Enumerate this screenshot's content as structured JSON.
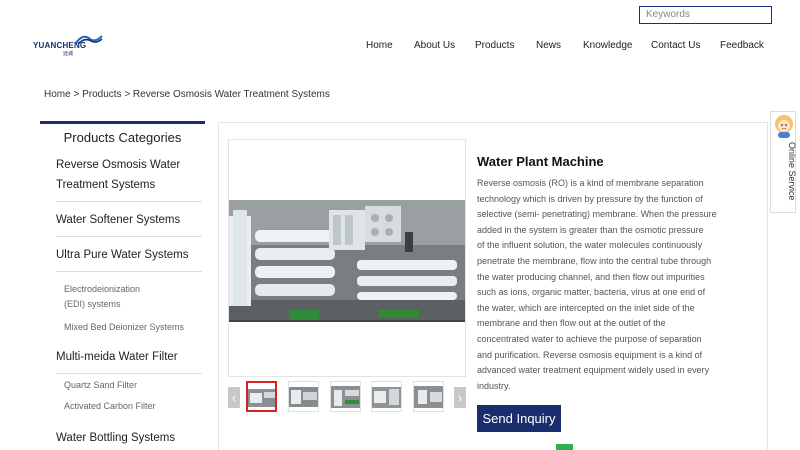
{
  "header": {
    "search_placeholder": "Keywords",
    "logo": {
      "name": "YUANCHENG",
      "sub": "远诚"
    },
    "nav": [
      "Home",
      "About Us",
      "Products",
      "News",
      "Knowledge",
      "Contact Us",
      "Feedback"
    ]
  },
  "breadcrumb": "Home > Products > Reverse Osmosis Water Treatment Systems",
  "sidebar": {
    "title": "Products Categories",
    "items": [
      {
        "label": "Reverse Osmosis Water\nTreatment Systems",
        "type": "main"
      },
      {
        "label": "Water Softener Systems",
        "type": "main"
      },
      {
        "label": "Ultra Pure Water Systems",
        "type": "main"
      },
      {
        "label": "Electrodeionization\n(EDI)  systems",
        "type": "sub"
      },
      {
        "label": "Mixed Bed Deionizer Systems",
        "type": "sub"
      },
      {
        "label": "Multi-meida Water Filter",
        "type": "main"
      },
      {
        "label": "Quartz Sand Filter",
        "type": "sub"
      },
      {
        "label": "Activated Carbon Filter",
        "type": "sub"
      },
      {
        "label": "Water Bottling Systems",
        "type": "main"
      }
    ]
  },
  "product": {
    "title": "Water Plant Machine",
    "description": "Reverse osmosis (RO) is a kind of membrane separation\ntechnology which is driven  by pressure by the function of\nselective (semi- penetrating) membrane. When the  pressure\nadded in the system is greater than the osmotic pressure\nof the influent  solution, the water molecules continuously\npenetrate the  membrane, flow into the central tube through\nthe water producing channel, and then flow out impurities\nsuch as ions, organic matter, bacteria, virus at  one end of\nthe water, which are intercepted on the inlet side of the\nmembrane  and then flow out at the outlet of the\nconcentrated water to achieve the purpose of separation\nand purification. Reverse osmosis equipment is a kind of\nadvanced water treatment equipment widely used in every\nindustry.",
    "inquiry_label": "Send Inquiry",
    "thumbnail_count": 5
  },
  "online_service": "Online Service",
  "colors": {
    "brand": "#1a2d6d",
    "active_thumb": "#d52424",
    "chat": "#2bb24c"
  }
}
